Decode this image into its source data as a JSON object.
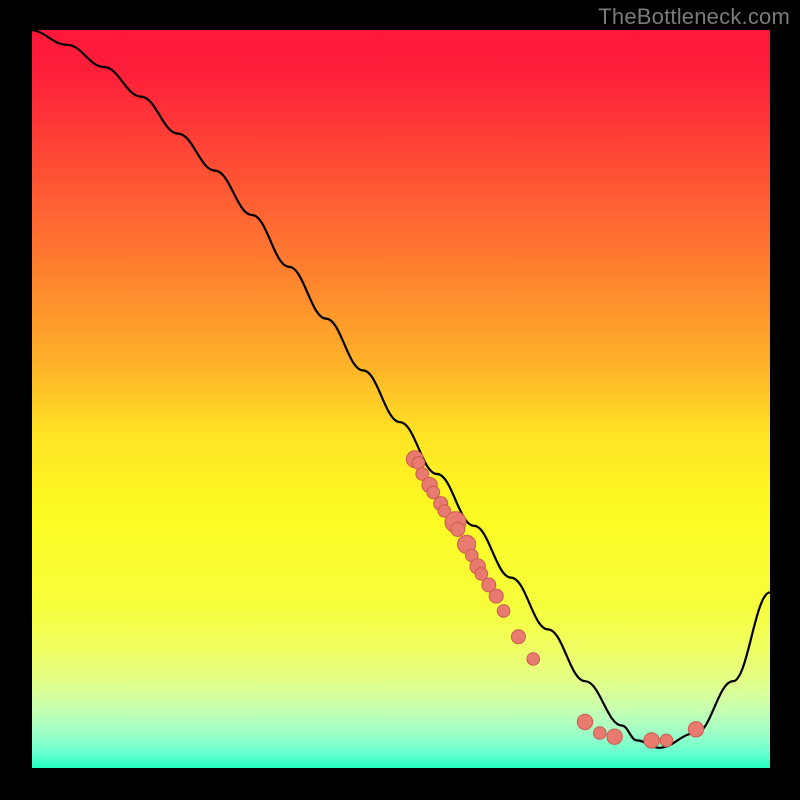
{
  "watermark": "TheBottleneck.com",
  "chart_data": {
    "type": "line",
    "title": "",
    "xlabel": "",
    "ylabel": "",
    "xlim": [
      0,
      100
    ],
    "ylim": [
      0,
      100
    ],
    "legend": false,
    "grid": false,
    "background": "rainbow-gradient",
    "series": [
      {
        "name": "curve",
        "x": [
          0,
          5,
          10,
          15,
          20,
          25,
          30,
          35,
          40,
          45,
          50,
          55,
          60,
          65,
          70,
          75,
          80,
          82,
          85,
          90,
          95,
          100
        ],
        "values": [
          100,
          98,
          95,
          91,
          86,
          81,
          75,
          68,
          61,
          54,
          47,
          40,
          33,
          26,
          19,
          12,
          6,
          4,
          3,
          5,
          12,
          24
        ]
      }
    ],
    "markers": [
      {
        "x": 52,
        "y": 42,
        "r": 1.2
      },
      {
        "x": 52.5,
        "y": 41.5,
        "r": 0.9
      },
      {
        "x": 53,
        "y": 40,
        "r": 0.9
      },
      {
        "x": 54,
        "y": 38.5,
        "r": 1.1
      },
      {
        "x": 54.5,
        "y": 37.5,
        "r": 0.9
      },
      {
        "x": 55.5,
        "y": 36,
        "r": 1.0
      },
      {
        "x": 56,
        "y": 35,
        "r": 0.9
      },
      {
        "x": 57.5,
        "y": 33.5,
        "r": 1.5
      },
      {
        "x": 57.8,
        "y": 32.5,
        "r": 1.0
      },
      {
        "x": 59,
        "y": 30.5,
        "r": 1.3
      },
      {
        "x": 59.7,
        "y": 29,
        "r": 0.9
      },
      {
        "x": 60.5,
        "y": 27.5,
        "r": 1.1
      },
      {
        "x": 61,
        "y": 26.5,
        "r": 0.9
      },
      {
        "x": 62,
        "y": 25,
        "r": 1.0
      },
      {
        "x": 63,
        "y": 23.5,
        "r": 1.0
      },
      {
        "x": 64,
        "y": 21.5,
        "r": 0.9
      },
      {
        "x": 66,
        "y": 18,
        "r": 1.0
      },
      {
        "x": 68,
        "y": 15,
        "r": 0.9
      },
      {
        "x": 75,
        "y": 6.5,
        "r": 1.1
      },
      {
        "x": 77,
        "y": 5,
        "r": 0.9
      },
      {
        "x": 79,
        "y": 4.5,
        "r": 1.1
      },
      {
        "x": 84,
        "y": 4,
        "r": 1.1
      },
      {
        "x": 86,
        "y": 4,
        "r": 0.9
      },
      {
        "x": 90,
        "y": 5.5,
        "r": 1.1
      }
    ],
    "colors": {
      "curve": "#000000",
      "markers": "#e87a6f",
      "background_top": "#ff173a",
      "background_bottom": "#17ffbe"
    }
  }
}
